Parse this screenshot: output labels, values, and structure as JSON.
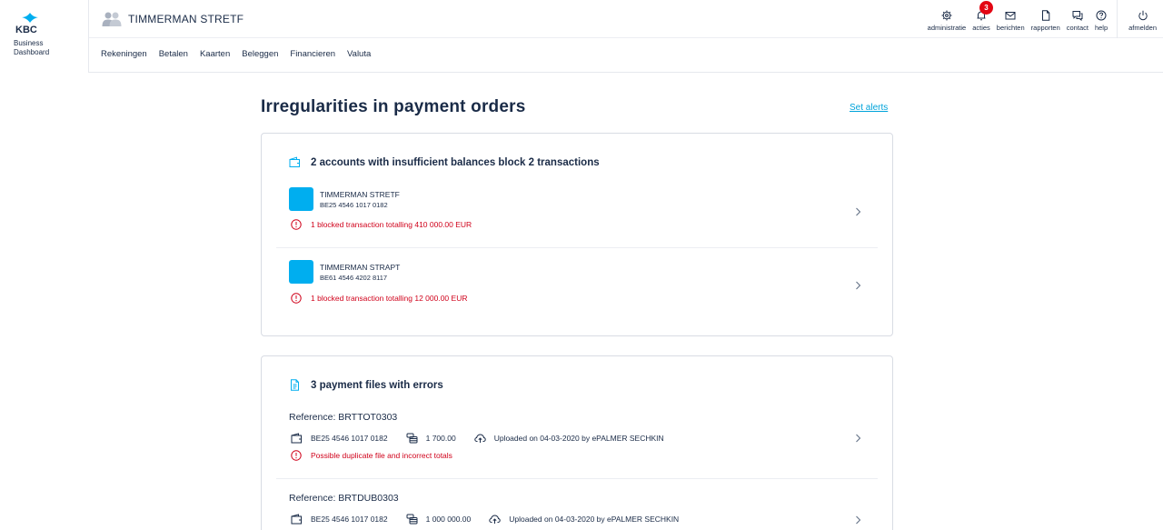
{
  "brand": {
    "logo_text": "KBC",
    "subtitle_line1": "Business",
    "subtitle_line2": "Dashboard"
  },
  "header": {
    "company_name": "TIMMERMAN STRETF",
    "tools": [
      {
        "label": "administratie",
        "icon": "gear-icon"
      },
      {
        "label": "acties",
        "icon": "bell-icon",
        "badge": "3"
      },
      {
        "label": "berichten",
        "icon": "envelope-icon"
      },
      {
        "label": "rapporten",
        "icon": "document-icon"
      },
      {
        "label": "contact",
        "icon": "chat-icon"
      },
      {
        "label": "help",
        "icon": "question-icon"
      }
    ],
    "logout_label": "afmelden"
  },
  "nav": [
    "Rekeningen",
    "Betalen",
    "Kaarten",
    "Beleggen",
    "Financieren",
    "Valuta"
  ],
  "main": {
    "title": "Irregularities in payment orders",
    "set_alerts": "Set alerts"
  },
  "blocked_card": {
    "heading": "2 accounts with insufficient balances block 2 transactions",
    "accounts": [
      {
        "name": "TIMMERMAN STRETF",
        "iban": "BE25 4546 1017 0182",
        "message": "1 blocked transaction totalling 410 000.00 EUR"
      },
      {
        "name": "TIMMERMAN STRAPT",
        "iban": "BE61 4546 4202 8117",
        "message": "1 blocked transaction totalling 12 000.00 EUR"
      }
    ]
  },
  "files_card": {
    "heading": "3 payment files with errors",
    "files": [
      {
        "reference": "Reference: BRTTOT0303",
        "account": "BE25 4546 1017 0182",
        "amount": "1 700.00",
        "uploaded": "Uploaded on 04-03-2020 by ePALMER SECHKIN",
        "message": "Possible duplicate file and incorrect totals"
      },
      {
        "reference": "Reference: BRTDUB0303",
        "account": "BE25 4546 1017 0182",
        "amount": "1 000 000.00",
        "uploaded": "Uploaded on 04-03-2020 by ePALMER SECHKIN",
        "message": ""
      }
    ]
  },
  "colors": {
    "brand_navy": "#1a2b47",
    "brand_blue": "#00aeef",
    "link": "#00a3da",
    "error": "#d0021b",
    "badge": "#e30613"
  }
}
